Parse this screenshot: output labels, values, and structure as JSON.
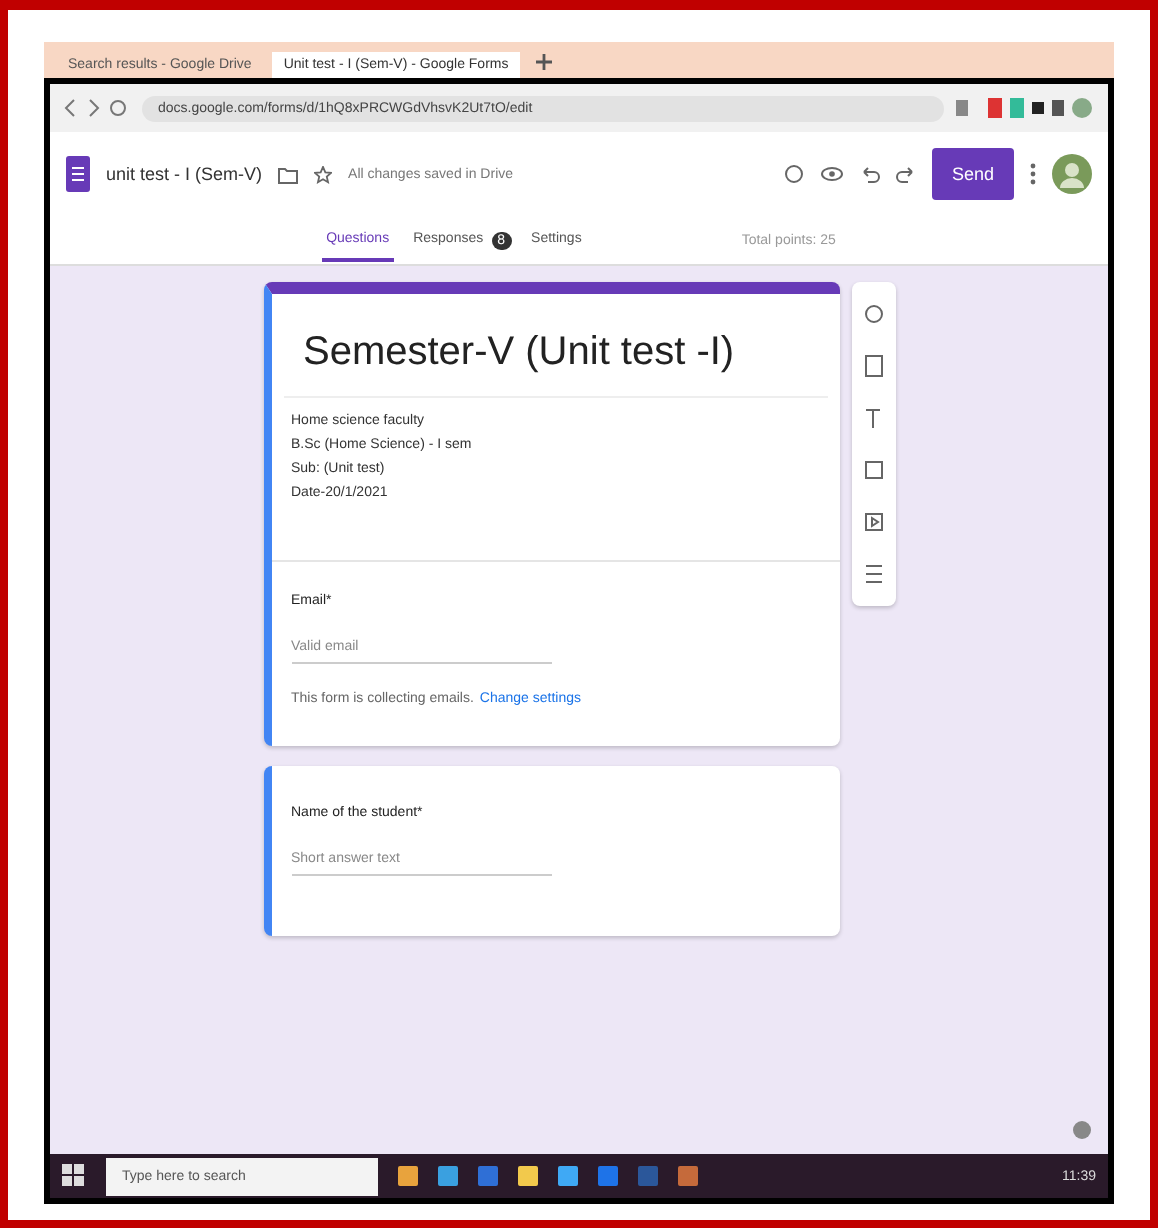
{
  "browser_tabs": [
    {
      "title": "Search results - Google Drive",
      "selected": false
    },
    {
      "title": "Unit test - I (Sem-V) - Google Forms",
      "selected": true
    }
  ],
  "address": "docs.google.com/forms/d/1hQ8xPRCWGdVhsvK2Ut7tO/edit",
  "form_header": {
    "title": "unit test - I (Sem-V)",
    "save_status": "All changes saved in Drive",
    "send_label": "Send"
  },
  "form_tabs": [
    {
      "label": "Questions",
      "selected": true
    },
    {
      "label": "Responses",
      "selected": false,
      "badge": "8"
    },
    {
      "label": "Settings",
      "selected": false
    }
  ],
  "total_points": "Total points: 25",
  "title_card": {
    "title": "Semester-V (Unit test -I)",
    "description": [
      "Home science faculty",
      "B.Sc (Home Science) - I sem",
      "Sub: (Unit test)",
      "Date-20/1/2021"
    ]
  },
  "questions": [
    {
      "kind": "attached",
      "label": "Email*",
      "placeholder": "Valid email",
      "note": "This form is collecting emails.",
      "link": "Change settings"
    },
    {
      "kind": "card",
      "label": "Name of the student*",
      "placeholder": "Short answer text"
    }
  ],
  "taskbar": {
    "search_placeholder": "Type here to search",
    "time": "11:39"
  }
}
